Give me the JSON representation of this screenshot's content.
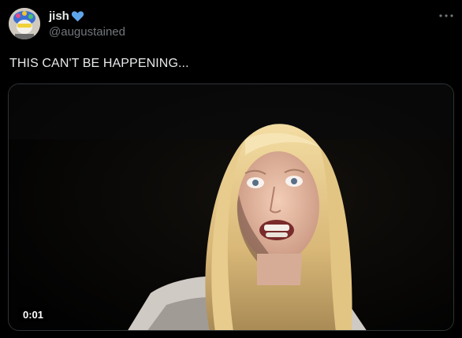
{
  "author": {
    "display_name": "jish",
    "handle": "@augustained",
    "verified_heart_color": "#5ea6ec"
  },
  "tweet": {
    "text": "THIS CAN'T BE HAPPENING..."
  },
  "video": {
    "elapsed": "0:01"
  },
  "icons": {
    "more": "more-horizontal-icon",
    "heart": "blue-heart-emoji"
  }
}
